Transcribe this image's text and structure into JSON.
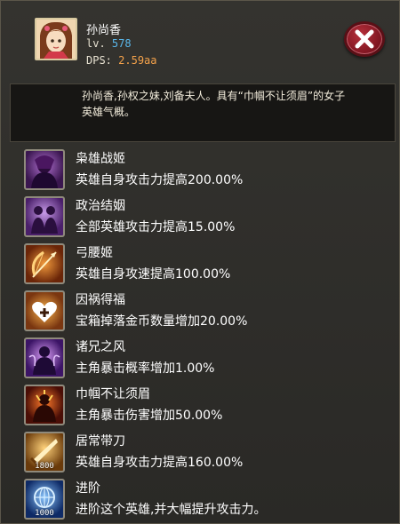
{
  "hero": {
    "name": "孙尚香",
    "level_label": "lv.",
    "level": "578",
    "dps_label": "DPS:",
    "dps": "2.59aa"
  },
  "description": "孙尚香,孙权之妹,刘备夫人。具有“巾帼不让须眉”的女子英雄气概。",
  "skills": [
    {
      "name": "枭雄战姬",
      "desc": "英雄自身攻击力提高200.00%",
      "icon": "dark-warrior-woman-icon",
      "color": "#5a2a7a"
    },
    {
      "name": "政治结姻",
      "desc": "全部英雄攻击力提高15.00%",
      "icon": "marriage-couple-icon",
      "color": "#6a2d8c"
    },
    {
      "name": "弓腰姬",
      "desc": "英雄自身攻速提高100.00%",
      "icon": "bow-arrow-icon",
      "color": "#b04a12"
    },
    {
      "name": "因祸得福",
      "desc": "宝箱掉落金币数量增加20.00%",
      "icon": "heart-plus-icon",
      "color": "#c0641a"
    },
    {
      "name": "诸兄之风",
      "desc": "主角暴击概率增加1.00%",
      "icon": "purple-aura-figure-icon",
      "color": "#5b2790"
    },
    {
      "name": "巾帼不让须眉",
      "desc": "主角暴击伤害增加50.00%",
      "icon": "fiery-figure-icon",
      "color": "#8a2a10"
    },
    {
      "name": "居常带刀",
      "desc": "英雄自身攻击力提高160.00%",
      "icon": "golden-blade-icon",
      "color": "#a8661a",
      "overlay": "1800"
    },
    {
      "name": "进阶",
      "desc": "进阶这个英雄,并大幅提升攻击力。",
      "icon": "upgrade-globe-icon",
      "color": "#1c4d9a",
      "overlay": "1000"
    }
  ],
  "colors": {
    "panel_bg": "#2b2a28",
    "level_value": "#5ab7ea",
    "dps_value": "#f3a14a",
    "close_button": "#9a1f2c"
  }
}
